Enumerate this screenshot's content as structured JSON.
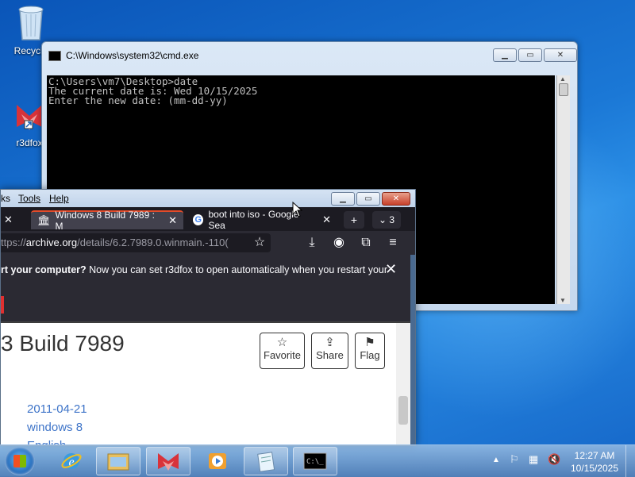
{
  "desktop": {
    "icons": [
      {
        "label": "Recycle"
      },
      {
        "label": "r3dfox"
      }
    ]
  },
  "cmd": {
    "title": "C:\\Windows\\system32\\cmd.exe",
    "lines": [
      "C:\\Users\\vm7\\Desktop>date",
      "The current date is: Wed 10/15/2025",
      "Enter the new date: (mm-dd-yy)"
    ]
  },
  "browser": {
    "menu": [
      "ks",
      "Tools",
      "Help"
    ],
    "tabs": [
      {
        "label": "Windows 8 Build 7989 : M",
        "active": true
      },
      {
        "label": "boot into iso - Google Sea",
        "active": false
      }
    ],
    "tab_count": "3",
    "url_prefix": "ttps://",
    "url_host": "archive.org",
    "url_path": "/details/6.2.7989.0.winmain.-110(",
    "notification": {
      "bold": "rt your computer?",
      "text": " Now you can set r3dfox to open automatically when you restart your"
    },
    "page": {
      "title": "3 Build 7989",
      "buttons": [
        {
          "icon": "star-icon",
          "label": "Favorite"
        },
        {
          "icon": "share-icon",
          "label": "Share"
        },
        {
          "icon": "flag-icon",
          "label": "Flag"
        }
      ],
      "meta": [
        "2011-04-21",
        "windows 8",
        "English"
      ]
    }
  },
  "taskbar": {
    "clock_time": "12:27 AM",
    "clock_date": "10/15/2025"
  },
  "colors": {
    "accent_tab": "#e24b2a",
    "link": "#3e74c8",
    "desktop_blue": "#1b78d6"
  }
}
